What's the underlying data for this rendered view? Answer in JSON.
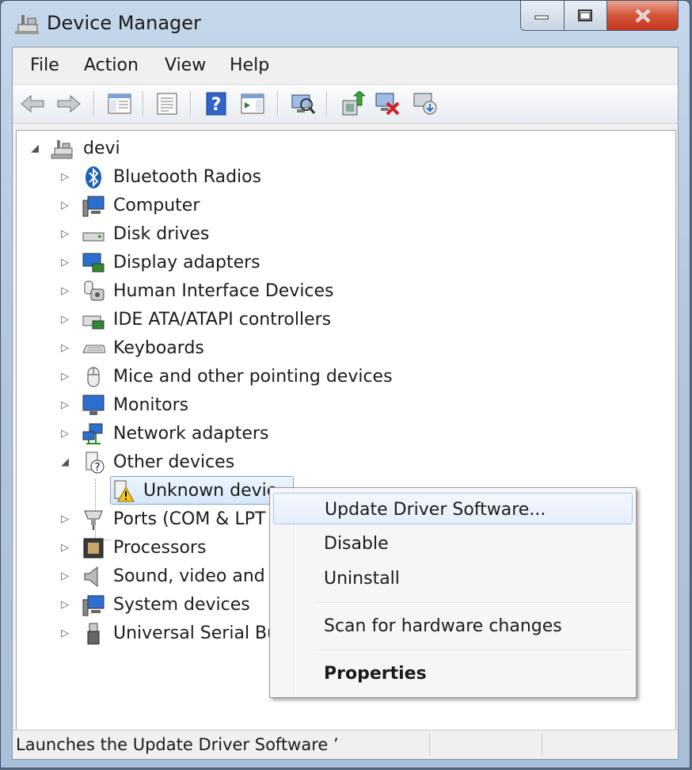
{
  "window": {
    "title": "Device Manager"
  },
  "menubar": [
    "File",
    "Action",
    "View",
    "Help"
  ],
  "toolbar": [
    {
      "name": "back-icon"
    },
    {
      "name": "forward-icon"
    },
    {
      "name": "show-hide-console-tree-icon"
    },
    {
      "name": "properties-icon"
    },
    {
      "name": "help-icon"
    },
    {
      "name": "show-action-pane-icon"
    },
    {
      "name": "scan-hardware-icon"
    },
    {
      "name": "update-driver-icon"
    },
    {
      "name": "disable-device-icon"
    },
    {
      "name": "uninstall-device-icon"
    }
  ],
  "tree": {
    "root": "devi",
    "categories": [
      {
        "label": "Bluetooth Radios",
        "icon": "bluetooth-icon"
      },
      {
        "label": "Computer",
        "icon": "computer-icon"
      },
      {
        "label": "Disk drives",
        "icon": "disk-drive-icon"
      },
      {
        "label": "Display adapters",
        "icon": "display-adapter-icon"
      },
      {
        "label": "Human Interface Devices",
        "icon": "hid-icon"
      },
      {
        "label": "IDE ATA/ATAPI controllers",
        "icon": "ide-controller-icon"
      },
      {
        "label": "Keyboards",
        "icon": "keyboard-icon"
      },
      {
        "label": "Mice and other pointing devices",
        "icon": "mouse-icon"
      },
      {
        "label": "Monitors",
        "icon": "monitor-icon"
      },
      {
        "label": "Network adapters",
        "icon": "network-adapter-icon"
      },
      {
        "label": "Other devices",
        "icon": "other-devices-icon",
        "expanded": true
      },
      {
        "label": "Ports (COM & LPT",
        "icon": "port-icon"
      },
      {
        "label": "Processors",
        "icon": "processor-icon"
      },
      {
        "label": "Sound, video and g",
        "icon": "sound-icon"
      },
      {
        "label": "System devices",
        "icon": "system-devices-icon"
      },
      {
        "label": "Universal Serial Bu",
        "icon": "usb-icon"
      }
    ],
    "unknown_device": "Unknown devic"
  },
  "context_menu": {
    "items": [
      {
        "label": "Update Driver Software...",
        "hover": true
      },
      {
        "label": "Disable"
      },
      {
        "label": "Uninstall"
      },
      {
        "label": "Scan for hardware changes"
      },
      {
        "label": "Properties",
        "bold": true
      }
    ]
  },
  "status": {
    "text": "Launches the Update Driver Software ’"
  }
}
